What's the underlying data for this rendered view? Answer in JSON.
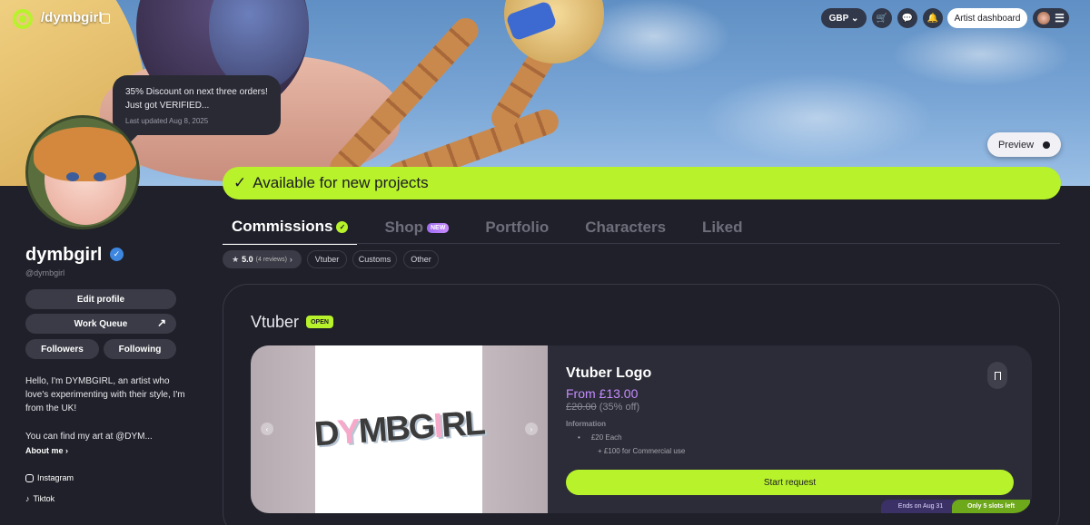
{
  "header": {
    "handle": "/dymbgirl",
    "currency": "GBP",
    "artist_dashboard": "Artist dashboard",
    "preview": "Preview"
  },
  "status": {
    "text": "35% Discount on next three orders! Just got VERIFIED...",
    "updated": "Last updated Aug 8, 2025"
  },
  "profile": {
    "name": "dymbgirl",
    "handle": "@dymbgirl",
    "edit_profile": "Edit profile",
    "work_queue": "Work Queue",
    "followers": "Followers",
    "following": "Following",
    "bio_1": "Hello, I'm DYMBGIRL, an artist who love's experimenting with their style, I'm from the UK!",
    "bio_2": "You can find my art at @DYM...",
    "about": "About me",
    "socials": [
      "Instagram",
      "Tiktok"
    ]
  },
  "availability": "Available for new projects",
  "tabs": [
    {
      "label": "Commissions",
      "active": true
    },
    {
      "label": "Shop",
      "badge": "NEW"
    },
    {
      "label": "Portfolio"
    },
    {
      "label": "Characters"
    },
    {
      "label": "Liked"
    }
  ],
  "filters": {
    "rating": "5.0",
    "reviews": "(4 reviews)",
    "chips": [
      "Vtuber",
      "Customs",
      "Other"
    ]
  },
  "section": {
    "title": "Vtuber",
    "status": "OPEN"
  },
  "card": {
    "title": "Vtuber Logo",
    "price": "From £13.00",
    "old_price": "£20.00",
    "discount": "(35% off)",
    "info_label": "Information",
    "info_items": [
      "£20 Each",
      "+ £100 for Commercial use"
    ],
    "start": "Start request",
    "ends": "Ends on Aug 31",
    "slots": "Only 5 slots left"
  },
  "colors": {
    "accent": "#b7f22b",
    "background": "#1f2029",
    "price": "#c58cff"
  }
}
